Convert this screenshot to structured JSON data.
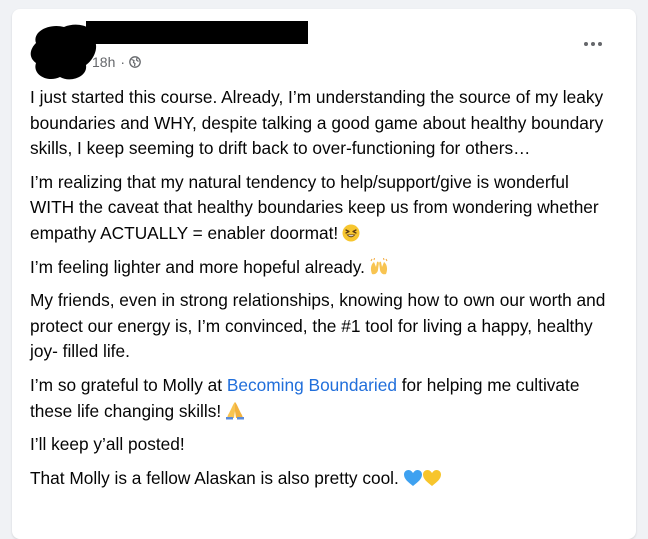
{
  "post": {
    "time": "18h",
    "separator": "·",
    "audience_icon": "globe-icon",
    "more_icon": "more-options-icon",
    "paragraphs": {
      "p1": "I just started this course. Already, I’m understanding the source of my leaky boundaries and WHY, despite talking a good game about healthy boundary skills, I keep seeming to drift back to over-functioning for others…",
      "p2": "I’m realizing that my natural tendency to help/support/give is wonderful WITH the caveat that healthy boundaries keep us from wondering whether empathy ACTUALLY = enabler doormat!",
      "p3": "I’m feeling lighter and more hopeful already.",
      "p4": "My friends, even in strong relationships, knowing how to own our worth and protect our energy is, I’m convinced, the #1 tool for living a happy, healthy joy- filled life.",
      "p5_before": "I’m so grateful to Molly at ",
      "p5_link": "Becoming Boundaried",
      "p5_after": " for helping me cultivate these life changing skills!",
      "p6": "I’ll keep y’all posted!",
      "p7": "That Molly is a fellow Alaskan is also pretty cool."
    },
    "emojis": {
      "p2": "laughing-face-emoji",
      "p3": "raising-hands-emoji",
      "p5": "folded-hands-emoji",
      "p7": "blue-heart-yellow-heart-emoji"
    },
    "colors": {
      "link": "#216fdb",
      "text": "#050505",
      "meta": "#65676b",
      "background": "#f0f2f5"
    }
  }
}
